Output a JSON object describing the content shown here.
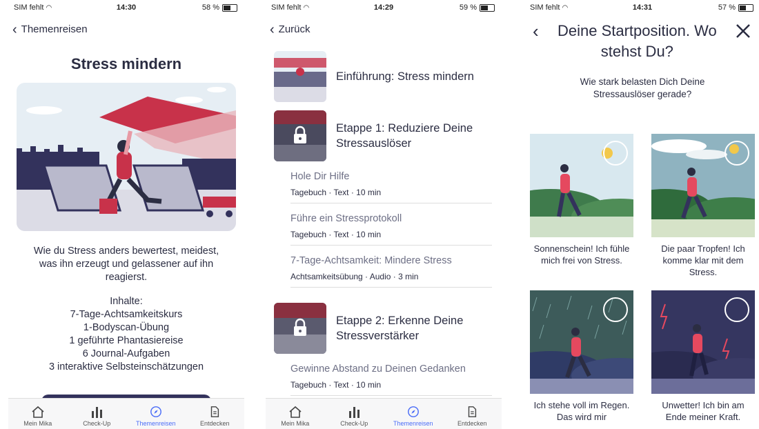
{
  "phone1": {
    "status": {
      "carrier": "SIM fehlt",
      "time": "14:30",
      "battery": "58 %"
    },
    "nav": {
      "back_label": "Themenreisen"
    },
    "title": "Stress mindern",
    "description": "Wie du Stress anders bewertest, meidest, was ihn erzeugt und gelassener auf ihn reagierst.",
    "contents_heading": "Inhalte:",
    "contents": [
      "7-Tage-Achtsamkeitskurs",
      "1-Bodyscan-Übung",
      "1 geführte Phantasiereise",
      "6 Journal-Aufgaben",
      "3 interaktive Selbsteinschätzungen"
    ]
  },
  "phone2": {
    "status": {
      "carrier": "SIM fehlt",
      "time": "14:29",
      "battery": "59 %"
    },
    "nav": {
      "back_label": "Zurück"
    },
    "intro_title": "Einführung: Stress mindern",
    "stage1_title": "Etappe 1: Reduziere Deine Stressauslöser",
    "stage1_lessons": [
      {
        "title": "Hole Dir Hilfe",
        "meta": "Tagebuch · Text · 10 min"
      },
      {
        "title": "Führe ein Stressprotokoll",
        "meta": "Tagebuch · Text · 10 min"
      },
      {
        "title": "7-Tage-Achtsamkeit: Mindere Stress",
        "meta": "Achtsamkeitsübung · Audio · 3 min"
      }
    ],
    "stage2_title": "Etappe 2: Erkenne Deine Stressverstärker",
    "stage2_lessons": [
      {
        "title": "Gewinne Abstand zu Deinen Gedanken",
        "meta": "Tagebuch · Text · 10 min"
      }
    ]
  },
  "phone3": {
    "status": {
      "carrier": "SIM fehlt",
      "time": "14:31",
      "battery": "57 %"
    },
    "title": "Deine Startposition. Wo stehst Du?",
    "subtitle": "Wie stark belasten Dich Deine Stressauslöser gerade?",
    "options": [
      {
        "caption": "Sonnenschein! Ich fühle mich frei von Stress."
      },
      {
        "caption": "Die paar Tropfen! Ich komme klar mit dem Stress."
      },
      {
        "caption": "Ich stehe voll im Regen. Das wird mir"
      },
      {
        "caption": "Unwetter! Ich bin am Ende meiner Kraft."
      }
    ]
  },
  "tabs": [
    "Mein Mika",
    "Check-Up",
    "Themenreisen",
    "Entdecken"
  ],
  "colors": {
    "accent": "#4a6cf7",
    "text": "#2b2d42",
    "brand_red": "#c8324a",
    "dark_indigo": "#33325c"
  }
}
